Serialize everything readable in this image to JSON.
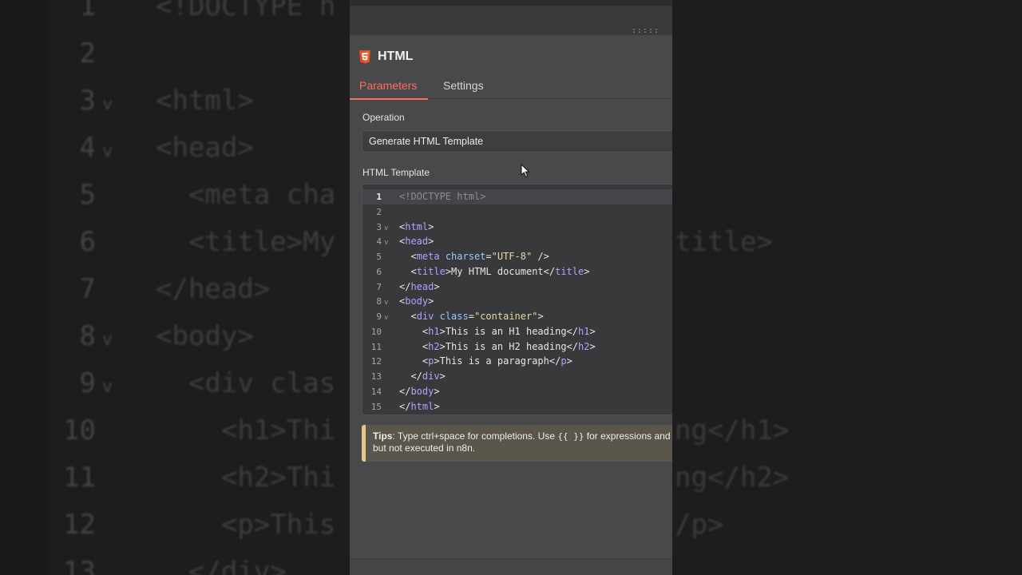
{
  "background_editor": {
    "lines": [
      {
        "num": "1",
        "code": "<!DOCTYPE h",
        "chevron": false
      },
      {
        "num": "2",
        "code": "",
        "chevron": false
      },
      {
        "num": "3",
        "code": "<html>",
        "chevron": true
      },
      {
        "num": "4",
        "code": "<head>",
        "chevron": true
      },
      {
        "num": "5",
        "code": "  <meta cha",
        "chevron": false
      },
      {
        "num": "6",
        "code": "  <title>My",
        "chevron": false
      },
      {
        "num": "7",
        "code": "</head>",
        "chevron": false
      },
      {
        "num": "8",
        "code": "<body>",
        "chevron": true
      },
      {
        "num": "9",
        "code": "  <div clas",
        "chevron": true
      },
      {
        "num": "10",
        "code": "    <h1>Thi",
        "chevron": false
      },
      {
        "num": "11",
        "code": "    <h2>Thi",
        "chevron": false
      },
      {
        "num": "12",
        "code": "    <p>This",
        "chevron": false
      },
      {
        "num": "13",
        "code": "  </div>",
        "chevron": false
      }
    ],
    "right_fragments": [
      {
        "line": 6,
        "text": "title>"
      },
      {
        "line": 10,
        "text": "ng</h1>"
      },
      {
        "line": 11,
        "text": "ng</h2>"
      },
      {
        "line": 12,
        "text": "/p>"
      }
    ]
  },
  "panel": {
    "grip": ":::::",
    "node": {
      "title": "HTML",
      "icon": "html5-icon"
    },
    "tabs": [
      {
        "label": "Parameters",
        "active": true
      },
      {
        "label": "Settings",
        "active": false
      }
    ],
    "operation": {
      "label": "Operation",
      "value": "Generate HTML Template"
    },
    "template": {
      "label": "HTML Template",
      "lines": [
        {
          "num": "1",
          "fold": false,
          "active": true,
          "code": "<!DOCTYPE html>"
        },
        {
          "num": "2",
          "fold": false,
          "active": false,
          "code": ""
        },
        {
          "num": "3",
          "fold": true,
          "active": false,
          "code": "<html>"
        },
        {
          "num": "4",
          "fold": true,
          "active": false,
          "code": "<head>"
        },
        {
          "num": "5",
          "fold": false,
          "active": false,
          "code": "  <meta charset=\"UTF-8\" />"
        },
        {
          "num": "6",
          "fold": false,
          "active": false,
          "code": "  <title>My HTML document</title>"
        },
        {
          "num": "7",
          "fold": false,
          "active": false,
          "code": "</head>"
        },
        {
          "num": "8",
          "fold": true,
          "active": false,
          "code": "<body>"
        },
        {
          "num": "9",
          "fold": true,
          "active": false,
          "code": "  <div class=\"container\">"
        },
        {
          "num": "10",
          "fold": false,
          "active": false,
          "code": "    <h1>This is an H1 heading</h1>"
        },
        {
          "num": "11",
          "fold": false,
          "active": false,
          "code": "    <h2>This is an H2 heading</h2>"
        },
        {
          "num": "12",
          "fold": false,
          "active": false,
          "code": "    <p>This is a paragraph</p>"
        },
        {
          "num": "13",
          "fold": false,
          "active": false,
          "code": "  </div>"
        },
        {
          "num": "14",
          "fold": false,
          "active": false,
          "code": "</body>"
        },
        {
          "num": "15",
          "fold": false,
          "active": false,
          "code": "</html>"
        }
      ]
    },
    "tips": {
      "label": "Tips",
      "text_before": ": Type ctrl+space for completions. Use ",
      "code": "{{ }}",
      "text_after": " for expressions and",
      "line2": "but not executed in n8n."
    }
  },
  "colors": {
    "accent": "#ff6d5a",
    "tag": "#b6a0ff",
    "attr": "#9cc8ff",
    "string": "#e7d9a7",
    "tips_border": "#e8c78d"
  }
}
